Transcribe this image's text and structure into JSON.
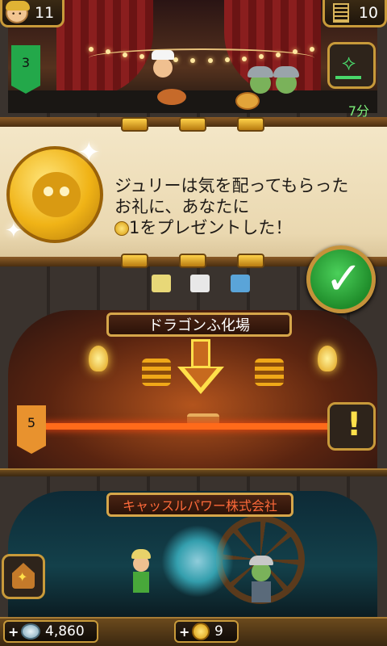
{
  "top_bar": {
    "population": "11",
    "floors": "10"
  },
  "bakery_floor": {
    "level": "3",
    "timer": "7分"
  },
  "notification": {
    "line1": "ジュリーは気を配ってもらった",
    "line2": "お礼に、あなたに",
    "line3_amount": "1",
    "line3_suffix": "をプレゼントした！"
  },
  "dragon_floor": {
    "name": "ドラゴンふ化場",
    "level": "5"
  },
  "castle_floor": {
    "name": "キャッスルパワー株式会社"
  },
  "currency": {
    "bux": "4,860",
    "coins": "9"
  },
  "icons": {
    "population": "avatar-face-icon",
    "floors": "tower-floors-icon",
    "confirm": "checkmark-icon",
    "alert": "exclamation-icon"
  },
  "colors": {
    "level_flag_green": "#23a84a",
    "level_flag_orange": "#e8922e",
    "confirm_green": "#2fa83a",
    "timer_text": "#7cf07a",
    "castle_sign_text": "#ff6a3a"
  }
}
